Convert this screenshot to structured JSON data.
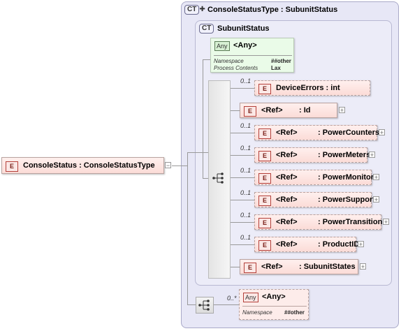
{
  "root_element": {
    "badge": "E",
    "name": "ConsoleStatus : ConsoleStatusType"
  },
  "outer_type": {
    "badge": "CT",
    "title": "ConsoleStatusType : SubunitStatus"
  },
  "inner_type": {
    "badge": "CT",
    "title": "SubunitStatus"
  },
  "any_top": {
    "badge": "Any",
    "title": "<Any>",
    "namespace_label": "Namespace",
    "namespace_value": "##other",
    "process_label": "Process Contents",
    "process_value": "Lax"
  },
  "children": [
    {
      "occurs": "0..1",
      "ref": "",
      "name": "DeviceErrors : int",
      "optional": true
    },
    {
      "occurs": "",
      "ref": "<Ref>",
      "name": ": Id",
      "optional": false
    },
    {
      "occurs": "0..1",
      "ref": "<Ref>",
      "name": ": PowerCounters",
      "optional": true
    },
    {
      "occurs": "0..1",
      "ref": "<Ref>",
      "name": ": PowerMeters",
      "optional": true
    },
    {
      "occurs": "0..1",
      "ref": "<Ref>",
      "name": ": PowerMonitor",
      "optional": true
    },
    {
      "occurs": "0..1",
      "ref": "<Ref>",
      "name": ": PowerSupport",
      "optional": true
    },
    {
      "occurs": "0..1",
      "ref": "<Ref>",
      "name": ": PowerTransition",
      "optional": true
    },
    {
      "occurs": "0..1",
      "ref": "<Ref>",
      "name": ": ProductID",
      "optional": true
    },
    {
      "occurs": "",
      "ref": "<Ref>",
      "name": ": SubunitStates",
      "optional": false
    }
  ],
  "any_bottom": {
    "occurs": "0..*",
    "badge": "Any",
    "title": "<Any>",
    "namespace_label": "Namespace",
    "namespace_value": "##other"
  },
  "element_badge": "E"
}
